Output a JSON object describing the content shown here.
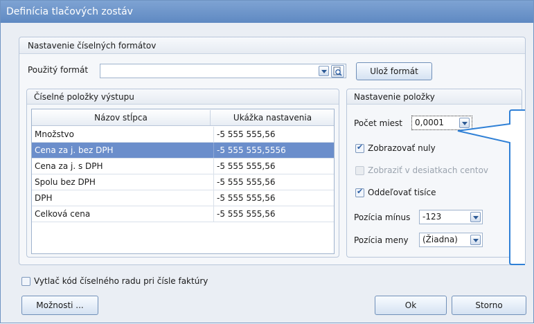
{
  "window": {
    "title": "Definícia tlačových zostáv"
  },
  "numeric_formats": {
    "group_title": "Nastavenie číselných formátov",
    "format_label": "Použitý formát",
    "format_value": "",
    "save_format_label": "Ulož formát"
  },
  "output_items": {
    "group_title": "Číselné položky výstupu",
    "columns": [
      "Názov stĺpca",
      "Ukážka nastavenia"
    ],
    "rows": [
      {
        "name": "Množstvo",
        "sample": "-5 555 555,56"
      },
      {
        "name": "Cena za j. bez DPH",
        "sample": "-5 555 555,5556"
      },
      {
        "name": "Cena za j. s DPH",
        "sample": "-5 555 555,56"
      },
      {
        "name": "Spolu bez DPH",
        "sample": "-5 555 555,56"
      },
      {
        "name": "DPH",
        "sample": "-5 555 555,56"
      },
      {
        "name": "Celková cena",
        "sample": "-5 555 555,56"
      }
    ],
    "selected_row": 1
  },
  "item_settings": {
    "group_title": "Nastavenie položky",
    "places_label": "Počet miest",
    "places_value": "0,0001",
    "show_zeros_label": "Zobrazovať nuly",
    "show_zeros_checked": true,
    "cents_label": "Zobraziť v desiatkach centov",
    "cents_checked": false,
    "thousands_label": "Oddeľovať tisíce",
    "thousands_checked": true,
    "minus_label": "Pozícia mínus",
    "minus_value": "-123",
    "currency_label": "Pozícia meny",
    "currency_value": "(Žiadna)"
  },
  "footer": {
    "print_code_label": "Vytlač kód číselného radu pri čísle faktúry",
    "print_code_checked": false,
    "options_label": "Možnosti ...",
    "ok_label": "Ok",
    "cancel_label": "Storno"
  },
  "colors": {
    "titlebar": "#6b93c8",
    "selection": "#6b8ecb",
    "dialog_bg": "#eaeef4"
  }
}
